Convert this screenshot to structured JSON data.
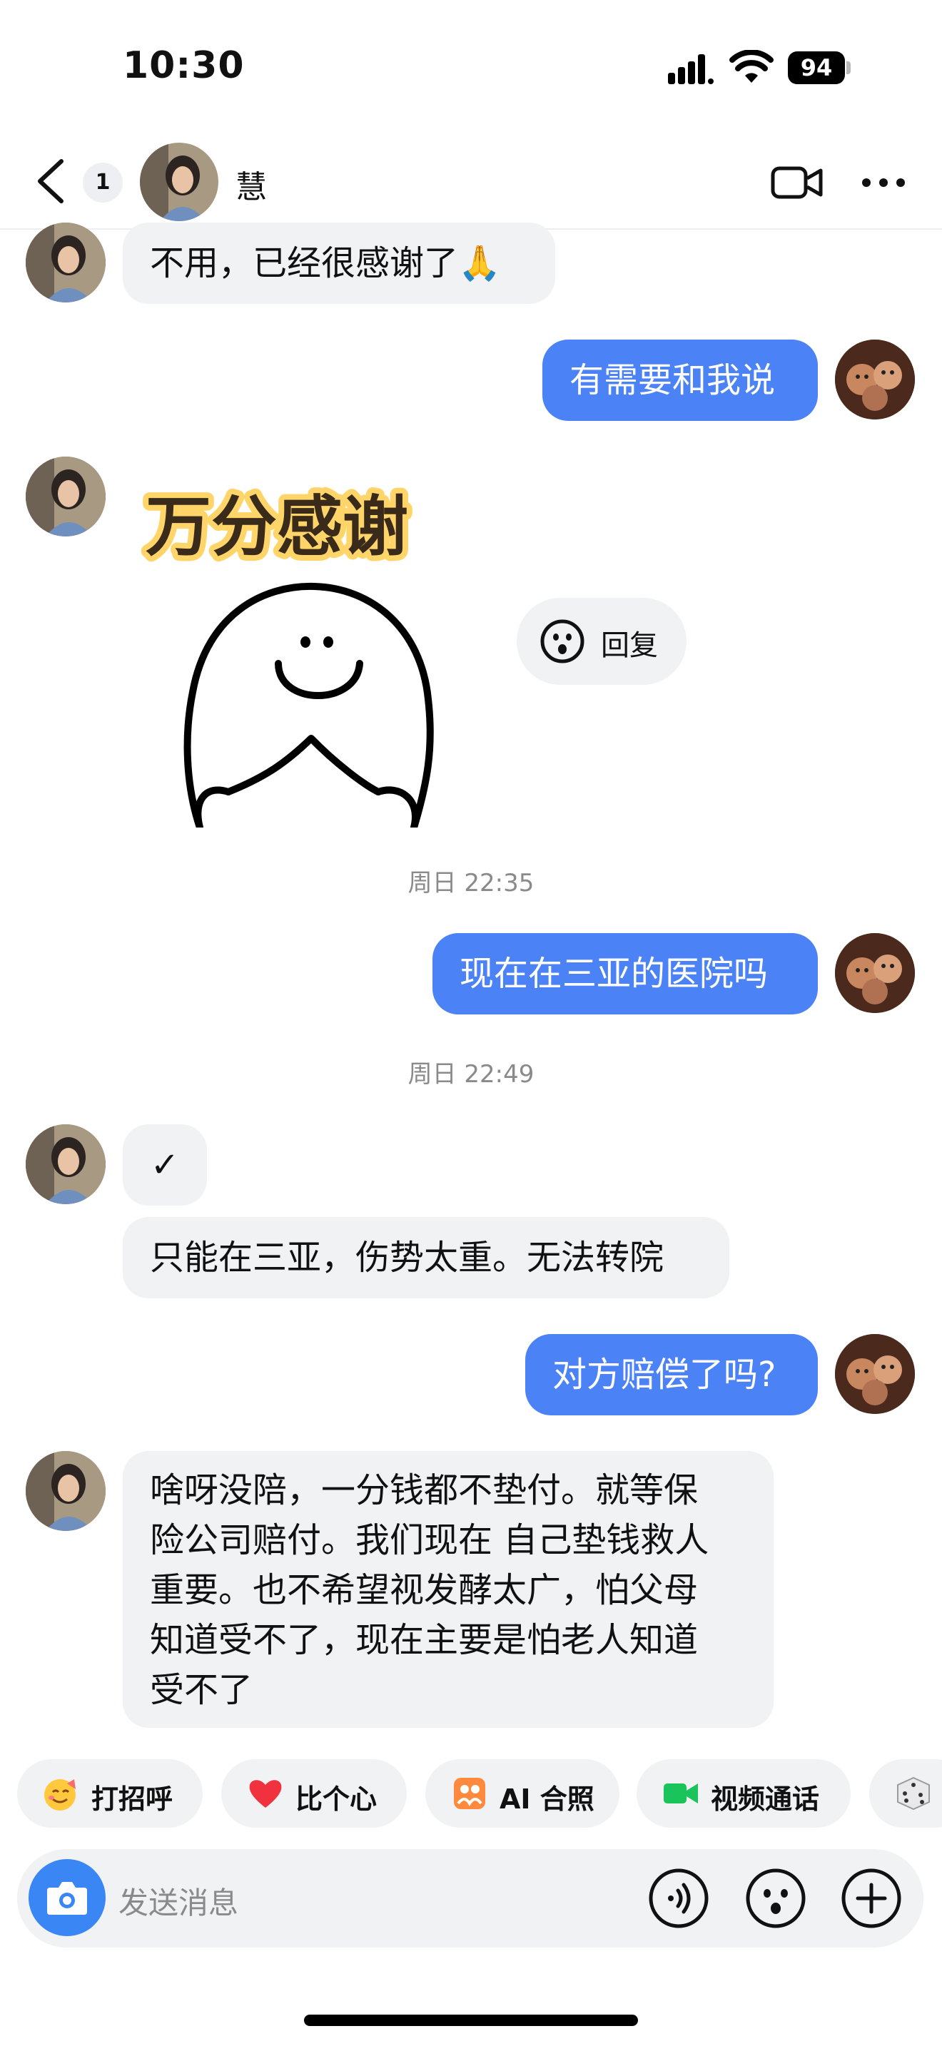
{
  "status_bar": {
    "time": "10:30",
    "battery": "94"
  },
  "header": {
    "unread_count": "1",
    "contact_name": "慧"
  },
  "messages": {
    "m1": "不用，已经很感谢了🙏",
    "m2": "有需要和我说",
    "sticker_text": "万分感谢",
    "reply_label": "回复",
    "ts1": "周日 22:35",
    "m3": "现在在三亚的医院吗",
    "ts2": "周日 22:49",
    "m4": "✓",
    "m5": "只能在三亚，伤势太重。无法转院",
    "m6": "对方赔偿了吗?",
    "m7_lines": [
      "啥呀没陪，一分钱都不垫付。就等保",
      "险公司赔付。我们现在 自己垫钱救人",
      "重要。也不希望视发酵太广，怕父母",
      "知道受不了，现在主要是怕老人知道",
      "受不了"
    ]
  },
  "quick_actions": [
    {
      "label": "打招呼",
      "icon": "smile-emoji-icon"
    },
    {
      "label": "比个心",
      "icon": "heart-icon"
    },
    {
      "label": "AI 合照",
      "icon": "ai-photo-icon"
    },
    {
      "label": "视频通话",
      "icon": "video-call-icon"
    },
    {
      "label": "",
      "icon": "dice-icon"
    }
  ],
  "input": {
    "placeholder": "发送消息"
  },
  "colors": {
    "outgoing_bubble": "#4b82f5",
    "incoming_bubble": "#f1f2f4",
    "camera_button": "#3a86f5",
    "video_call_green": "#19c45a"
  }
}
